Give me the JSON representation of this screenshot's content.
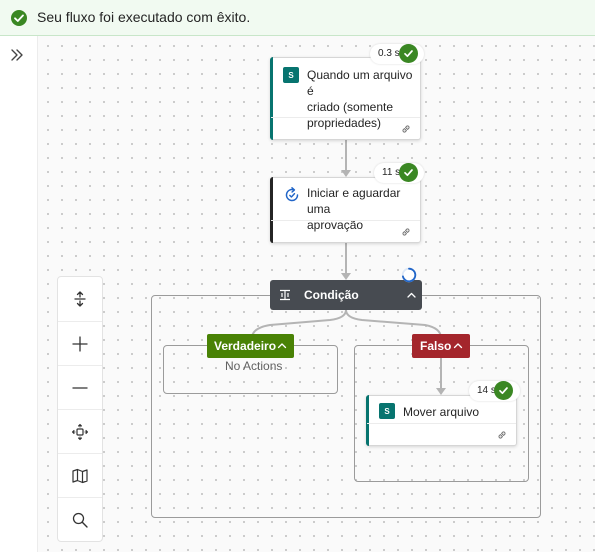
{
  "banner": {
    "message": "Seu fluxo foi executado com êxito.",
    "status_color": "#3a8723"
  },
  "sidebar": {
    "expand_icon": "chevron-double-right-icon"
  },
  "toolbar": {
    "tools": [
      {
        "name": "fit-vertical-icon"
      },
      {
        "name": "zoom-in-icon"
      },
      {
        "name": "zoom-out-icon"
      },
      {
        "name": "fit-view-icon"
      },
      {
        "name": "minimap-icon"
      },
      {
        "name": "search-icon"
      }
    ]
  },
  "flow": {
    "trigger": {
      "title": "Quando um arquivo é criado (somente propriedades)",
      "title_lines": [
        "Quando um arquivo é",
        "criado (somente",
        "propriedades)"
      ],
      "duration": "0.3 s",
      "icon": "sharepoint-icon",
      "accent_color": "#07746f"
    },
    "approval": {
      "title": "Iniciar e aguardar uma aprovação",
      "title_lines": [
        "Iniciar e aguardar uma",
        "aprovação"
      ],
      "duration": "11 s",
      "icon": "approval-icon",
      "accent_color": "#242424"
    },
    "condition": {
      "title": "Condição",
      "header_color": "#474b51",
      "true_branch": {
        "label": "Verdadeiro",
        "color": "#498205",
        "empty_text": "No Actions"
      },
      "false_branch": {
        "label": "Falso",
        "color": "#a4262c",
        "action": {
          "title": "Mover arquivo",
          "duration": "14 s",
          "icon": "sharepoint-icon",
          "accent_color": "#07746f"
        }
      }
    }
  }
}
